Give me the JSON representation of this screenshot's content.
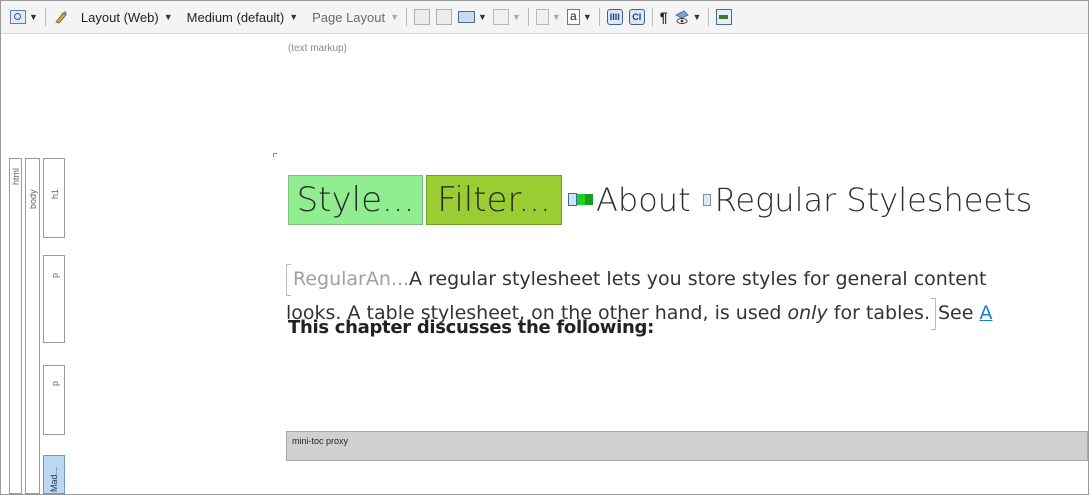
{
  "toolbar": {
    "layout_label": "Layout (Web)",
    "medium_label": "Medium (default)",
    "page_layout_label": "Page Layout"
  },
  "editor": {
    "markup_hint": "(text markup)"
  },
  "structure_bars": {
    "html": "html",
    "body": "body",
    "h1": "h1",
    "p1": "p",
    "p2": "p",
    "mad": "Mad..."
  },
  "document": {
    "heading": {
      "var_style": "Style...",
      "var_filter": "Filter...",
      "text_about": "About",
      "text_title": "Regular Stylesheets"
    },
    "paragraph": {
      "snippet_tag": "RegularAn...",
      "line1": "A regular stylesheet lets you store styles for general content",
      "line2_a": "looks. A table stylesheet, on the other hand, is used ",
      "line2_em": "only",
      "line2_b": " for tables.",
      "see": "See ",
      "link": "A"
    },
    "subheading": "This chapter discusses the following:",
    "proxy_label": "mini-toc proxy"
  },
  "colors": {
    "style_chip": "#90ee90",
    "filter_chip": "#9acd32",
    "link": "#1a7fc1",
    "proxy_bg": "#d0d0d0"
  }
}
